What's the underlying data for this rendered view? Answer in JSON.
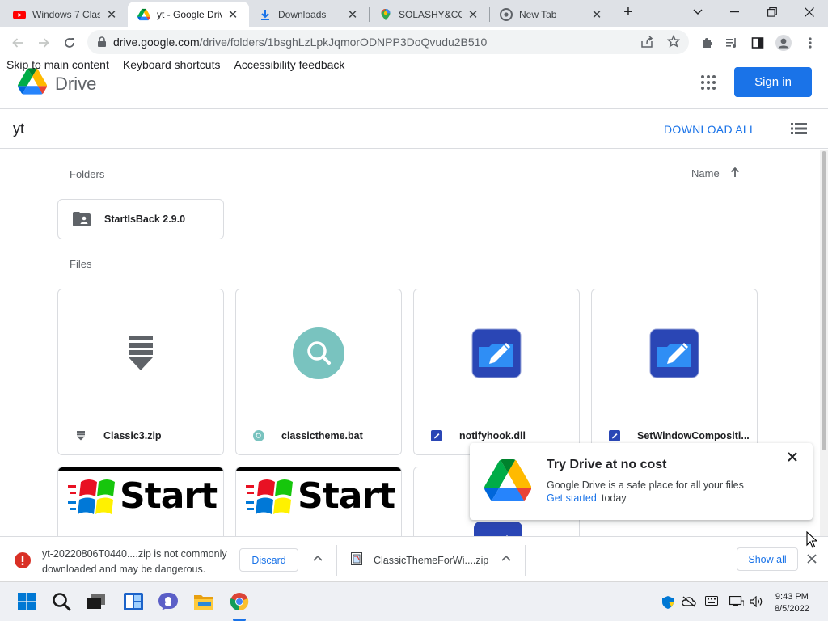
{
  "browser": {
    "tabs": [
      {
        "title": "Windows 7 Clas",
        "icon": "youtube-icon",
        "active": false
      },
      {
        "title": "yt - Google Driv",
        "icon": "google-drive-icon",
        "active": true
      },
      {
        "title": "Downloads",
        "icon": "download-icon",
        "active": false
      },
      {
        "title": "SOLASHY&CO -",
        "icon": "google-maps-icon",
        "active": false
      },
      {
        "title": "New Tab",
        "icon": "chrome-icon",
        "active": false
      }
    ],
    "url_host": "drive.google.com",
    "url_path": "/drive/folders/1bsghLzLpkJqmorODNPP3DoQvudu2B510"
  },
  "drive": {
    "skip_links": [
      "Skip to main content",
      "Keyboard shortcuts",
      "Accessibility feedback"
    ],
    "logo_text": "Drive",
    "sign_in_label": "Sign in",
    "folder_title": "yt",
    "download_all_label": "DOWNLOAD ALL",
    "folders_label": "Folders",
    "files_label": "Files",
    "sort_label": "Name",
    "folders": [
      {
        "name": "StartIsBack 2.9.0"
      }
    ],
    "files": [
      {
        "name": "Classic3.zip",
        "type": "zip"
      },
      {
        "name": "classictheme.bat",
        "type": "bat"
      },
      {
        "name": "notifyhook.dll",
        "type": "dll"
      },
      {
        "name": "SetWindowCompositi...",
        "type": "dll"
      }
    ],
    "start_thumb_text": "Start"
  },
  "promo": {
    "title": "Try Drive at no cost",
    "body": "Google Drive is a safe place for all your files",
    "link": "Get started",
    "tail": "today"
  },
  "downloads": {
    "warning_line1": "yt-20220806T0440....zip is not commonly",
    "warning_line2": "downloaded and may be dangerous.",
    "discard_label": "Discard",
    "file2_name": "ClassicThemeForWi....zip",
    "show_all_label": "Show all"
  },
  "taskbar": {
    "time": "9:43 PM",
    "date": "8/5/2022"
  },
  "colors": {
    "accent": "#1a73e8",
    "warning": "#d93025"
  }
}
